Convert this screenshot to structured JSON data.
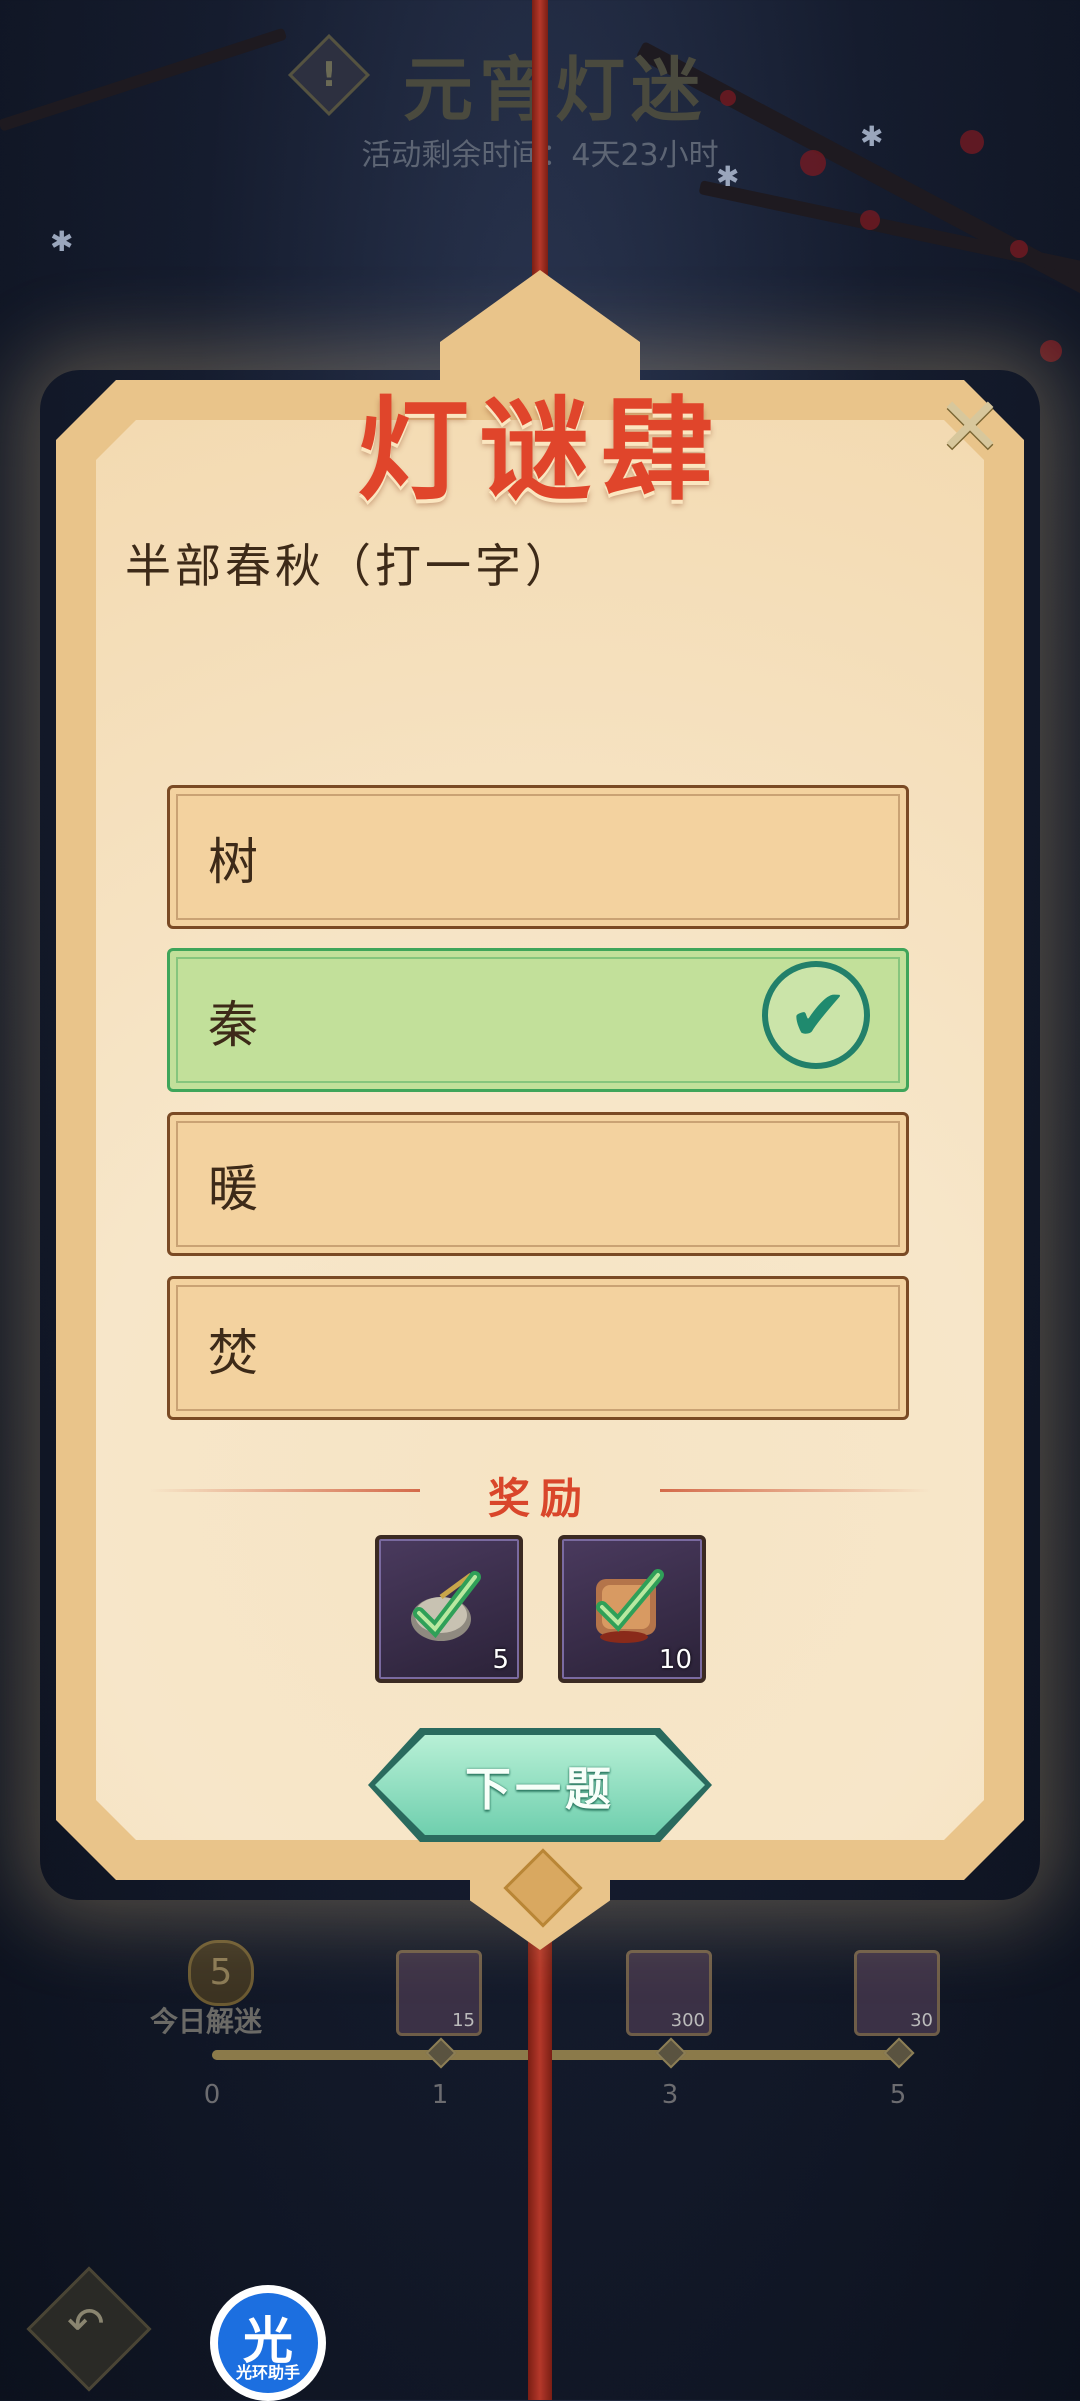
{
  "header": {
    "title": "元宵灯迷",
    "alert_icon_glyph": "!",
    "timer_text": "活动剩余时间：4天23小时"
  },
  "card": {
    "title": "灯谜肆",
    "close_glyph": "✕",
    "question": "半部春秋（打一字）",
    "options": [
      {
        "label": "树",
        "correct": false
      },
      {
        "label": "秦",
        "correct": true
      },
      {
        "label": "暖",
        "correct": false
      },
      {
        "label": "焚",
        "correct": false
      }
    ],
    "check_glyph": "✔",
    "reward_title": "奖励",
    "rewards": [
      {
        "icon": "pouch-icon",
        "quantity": "5"
      },
      {
        "icon": "scroll-icon",
        "quantity": "10"
      }
    ],
    "next_button": "下一题"
  },
  "progress": {
    "today_count": "5",
    "today_label": "今日解迷",
    "milestones": [
      "0",
      "1",
      "3",
      "5"
    ],
    "milestone_rewards": [
      "15",
      "300",
      "30"
    ],
    "fill_fraction": 1.0
  },
  "footer": {
    "back_glyph": "↶",
    "helper_glyph": "光",
    "helper_label": "光环助手"
  },
  "colors": {
    "title_red": "#e0452b",
    "correct_green": "#c2e09a",
    "card_frame": "#e9c48a",
    "button_teal": "#6fcfae"
  }
}
